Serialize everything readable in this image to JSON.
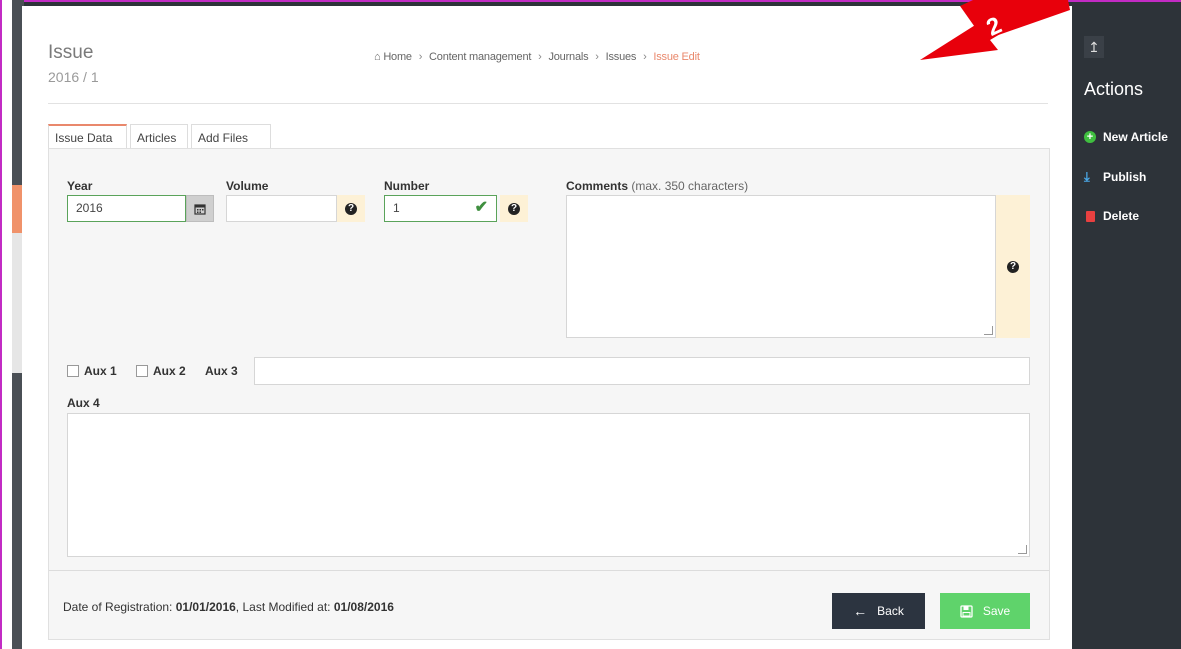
{
  "header": {
    "title": "Issue",
    "subtitle": "2016 / 1"
  },
  "breadcrumb": {
    "home": "Home",
    "items": [
      "Content management",
      "Journals",
      "Issues"
    ],
    "active": "Issue Edit",
    "separator": "›"
  },
  "tabs": [
    {
      "label": "Issue Data",
      "active": true
    },
    {
      "label": "Articles",
      "active": false
    },
    {
      "label": "Add Files",
      "active": false
    }
  ],
  "form": {
    "year_label": "Year",
    "year_value": "2016",
    "volume_label": "Volume",
    "volume_value": "",
    "number_label": "Number",
    "number_value": "1",
    "comments_label": "Comments",
    "comments_hint": "(max. 350 characters)",
    "comments_value": "",
    "aux1_label": "Aux 1",
    "aux2_label": "Aux 2",
    "aux3_label": "Aux 3",
    "aux3_value": "",
    "aux4_label": "Aux 4",
    "aux4_value": ""
  },
  "footer": {
    "registration_label": "Date of Registration:",
    "registration_date": "01/01/2016",
    "modified_label": ", Last Modified at:",
    "modified_date": "01/08/2016",
    "back_label": "Back",
    "save_label": "Save"
  },
  "sidebar": {
    "title": "Actions",
    "items": [
      {
        "label": "New Article",
        "icon": "plus-circle-icon"
      },
      {
        "label": "Publish",
        "icon": "download-icon"
      },
      {
        "label": "Delete",
        "icon": "trash-icon"
      }
    ]
  },
  "annotation": {
    "number": "2",
    "color": "#e8000b"
  },
  "colors": {
    "accent": "#e9886c",
    "save_green": "#5fd36b",
    "dark": "#2d3339"
  }
}
